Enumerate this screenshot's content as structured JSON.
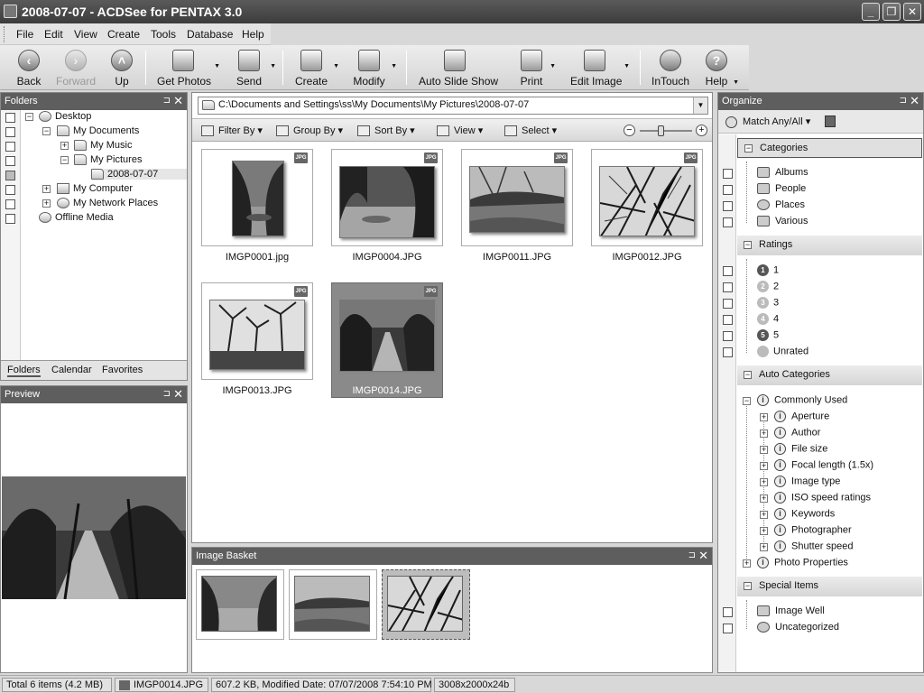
{
  "window": {
    "title": "2008-07-07 - ACDSee for PENTAX 3.0",
    "min": "_",
    "max": "❐",
    "close": "✕"
  },
  "menu": [
    "File",
    "Edit",
    "View",
    "Create",
    "Tools",
    "Database",
    "Help"
  ],
  "toolbar": {
    "back": "Back",
    "forward": "Forward",
    "up": "Up",
    "get_photos": "Get Photos",
    "send": "Send",
    "create": "Create",
    "modify": "Modify",
    "slideshow": "Auto Slide Show",
    "print": "Print",
    "edit_image": "Edit Image",
    "intouch": "InTouch",
    "help": "Help"
  },
  "folders_panel": {
    "title": "Folders",
    "tree": [
      "Desktop",
      "My Documents",
      "My Music",
      "My Pictures",
      "2008-07-07",
      "My Computer",
      "My Network Places",
      "Offline Media"
    ],
    "tabs": [
      "Folders",
      "Calendar",
      "Favorites"
    ]
  },
  "preview_panel": {
    "title": "Preview"
  },
  "browser": {
    "path": "C:\\Documents and Settings\\ss\\My Documents\\My Pictures\\2008-07-07",
    "filter_by": "Filter By",
    "group_by": "Group By",
    "sort_by": "Sort By",
    "view": "View",
    "select": "Select",
    "zoom_level": 0.4,
    "badge": "JPG",
    "files": [
      "IMGP0001.jpg",
      "IMGP0004.JPG",
      "IMGP0011.JPG",
      "IMGP0012.JPG",
      "IMGP0013.JPG",
      "IMGP0014.JPG"
    ]
  },
  "basket": {
    "title": "Image Basket"
  },
  "organize": {
    "title": "Organize",
    "match": "Match Any/All",
    "categories_title": "Categories",
    "categories": [
      "Albums",
      "People",
      "Places",
      "Various"
    ],
    "ratings_title": "Ratings",
    "ratings": [
      "1",
      "2",
      "3",
      "4",
      "5",
      "Unrated"
    ],
    "auto_title": "Auto Categories",
    "auto": [
      "Commonly Used",
      "Aperture",
      "Author",
      "File size",
      "Focal length (1.5x)",
      "Image type",
      "ISO speed ratings",
      "Keywords",
      "Photographer",
      "Shutter speed",
      "Photo Properties"
    ],
    "special_title": "Special Items",
    "special": [
      "Image Well",
      "Uncategorized"
    ]
  },
  "status": {
    "total": "Total 6 items  (4.2 MB)",
    "file": "IMGP0014.JPG",
    "info": "607.2 KB, Modified Date: 07/07/2008 7:54:10 PM",
    "dims": "3008x2000x24b"
  }
}
